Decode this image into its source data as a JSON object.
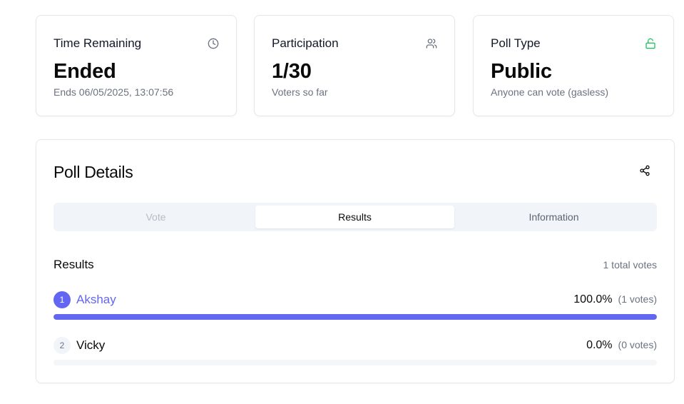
{
  "stats": {
    "time": {
      "title": "Time Remaining",
      "value": "Ended",
      "sub": "Ends 06/05/2025, 13:07:56",
      "icon": "clock-icon"
    },
    "participation": {
      "title": "Participation",
      "value": "1/30",
      "sub": "Voters so far",
      "icon": "users-icon"
    },
    "poll_type": {
      "title": "Poll Type",
      "value": "Public",
      "sub": "Anyone can vote (gasless)",
      "icon": "unlock-icon",
      "icon_color": "#22c55e"
    }
  },
  "poll": {
    "title": "Poll Details",
    "share_icon": "share-icon",
    "tabs": [
      {
        "label": "Vote"
      },
      {
        "label": "Results"
      },
      {
        "label": "Information"
      }
    ],
    "active_tab": "Results",
    "results": {
      "heading": "Results",
      "total": "1 total votes",
      "items": [
        {
          "rank": "1",
          "name": "Akshay",
          "percent": "100.0%",
          "votes": "(1 votes)",
          "fraction": 1.0
        },
        {
          "rank": "2",
          "name": "Vicky",
          "percent": "0.0%",
          "votes": "(0 votes)",
          "fraction": 0.0
        }
      ]
    }
  },
  "colors": {
    "accent": "#6366f1",
    "green": "#22c55e"
  }
}
